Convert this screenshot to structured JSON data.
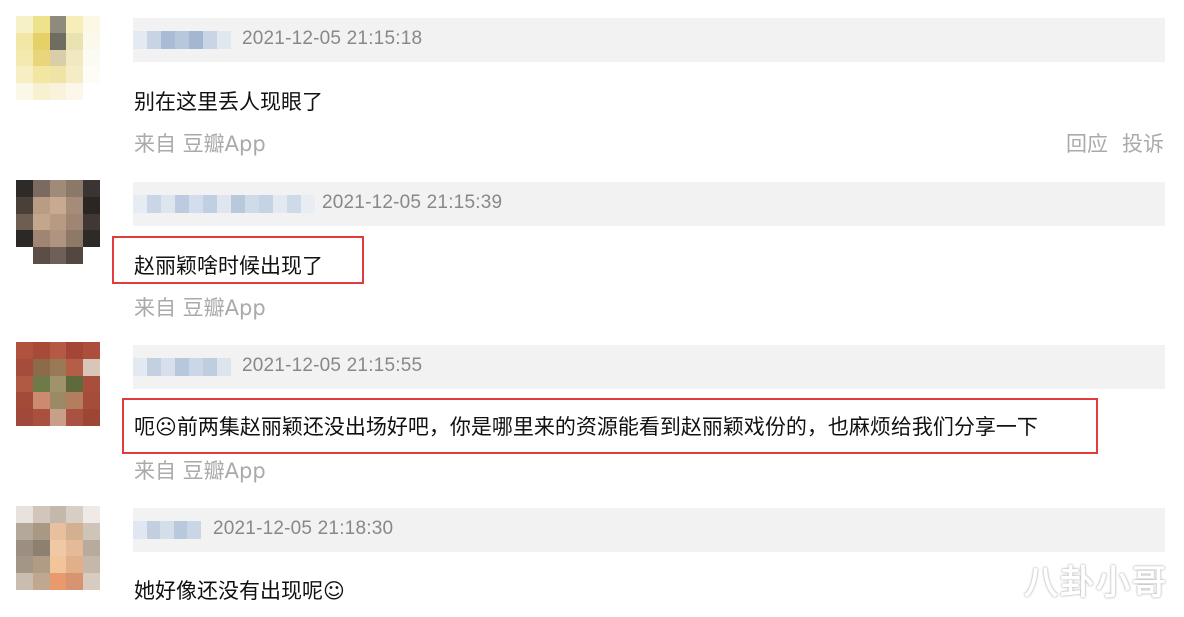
{
  "comments": [
    {
      "timestamp": "2021-12-05 21:15:18",
      "content": "别在这里丢人现眼了",
      "source": "来自 豆瓣App",
      "actions": [
        "回应",
        "投诉"
      ],
      "highlighted": false
    },
    {
      "timestamp": "2021-12-05 21:15:39",
      "content": "赵丽颖啥时候出现了",
      "source": "来自 豆瓣App",
      "actions": [],
      "highlighted": true
    },
    {
      "timestamp": "2021-12-05 21:15:55",
      "content": "呃☹前两集赵丽颖还没出场好吧，你是哪里来的资源能看到赵丽颖戏份的，也麻烦给我们分享一下",
      "source": "来自 豆瓣App",
      "actions": [],
      "highlighted": true
    },
    {
      "timestamp": "2021-12-05 21:18:30",
      "content": "她好像还没有出现呢☺",
      "source": "",
      "actions": [],
      "highlighted": false
    }
  ],
  "watermark": "八卦小哥",
  "colors": {
    "highlight_border": "#e03c3c",
    "meta_background": "#f2f2f2",
    "muted_text": "#aaaaaa"
  }
}
